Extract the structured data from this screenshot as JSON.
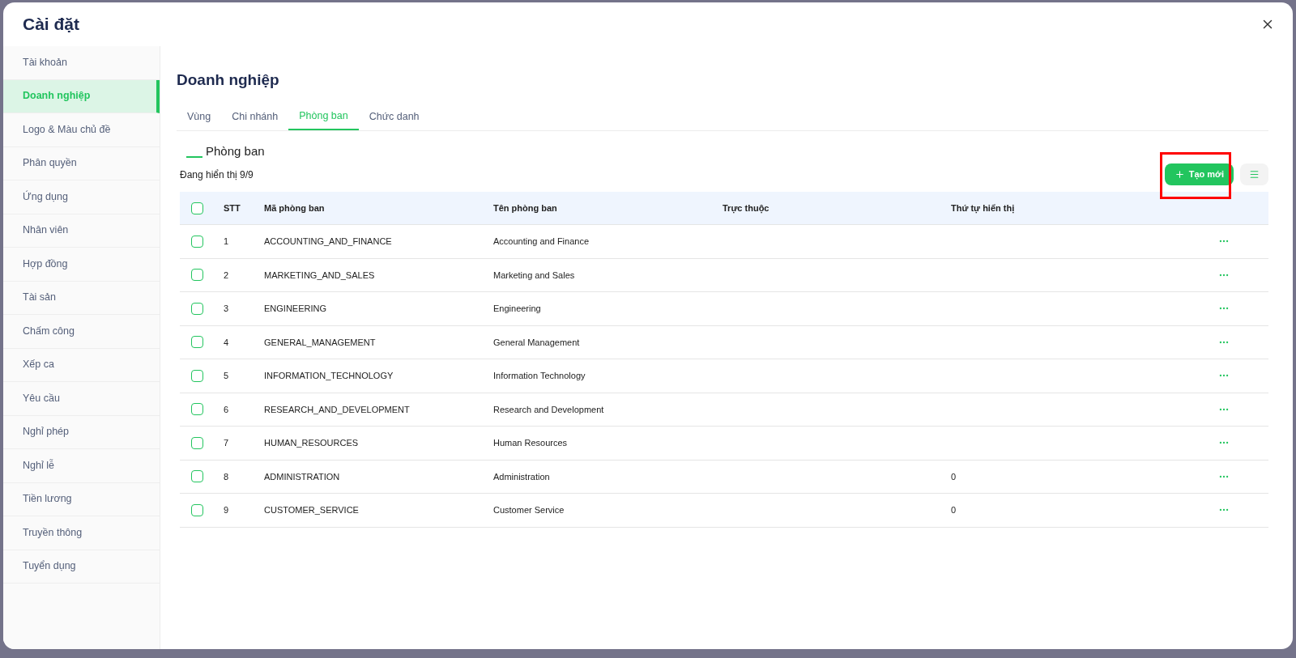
{
  "dialog": {
    "title": "Cài đặt"
  },
  "sidebar": {
    "items": [
      {
        "label": "Tài khoản",
        "selected": false
      },
      {
        "label": "Doanh nghiệp",
        "selected": true
      },
      {
        "label": "Logo & Màu chủ đề",
        "selected": false
      },
      {
        "label": "Phân quyền",
        "selected": false
      },
      {
        "label": "Ứng dụng",
        "selected": false
      },
      {
        "label": "Nhân viên",
        "selected": false
      },
      {
        "label": "Hợp đồng",
        "selected": false
      },
      {
        "label": "Tài sản",
        "selected": false
      },
      {
        "label": "Chấm công",
        "selected": false
      },
      {
        "label": "Xếp ca",
        "selected": false
      },
      {
        "label": "Yêu cầu",
        "selected": false
      },
      {
        "label": "Nghỉ phép",
        "selected": false
      },
      {
        "label": "Nghỉ lễ",
        "selected": false
      },
      {
        "label": "Tiền lương",
        "selected": false
      },
      {
        "label": "Truyền thông",
        "selected": false
      },
      {
        "label": "Tuyển dụng",
        "selected": false
      }
    ]
  },
  "content": {
    "heading": "Doanh nghiệp",
    "tabs": [
      {
        "label": "Vùng",
        "selected": false
      },
      {
        "label": "Chi nhánh",
        "selected": false
      },
      {
        "label": "Phòng ban",
        "selected": true
      },
      {
        "label": "Chức danh",
        "selected": false
      }
    ],
    "section_title": "Phòng ban",
    "count_text": "Đang hiển thị 9/9",
    "create_button": {
      "label": "Tạo mới",
      "highlighted": true
    },
    "table": {
      "select_all_checked": false,
      "columns": [
        "STT",
        "Mã phòng ban",
        "Tên phòng ban",
        "Trực thuộc",
        "Thứ tự hiển thị"
      ],
      "rows": [
        {
          "no": "1",
          "code": "ACCOUNTING_AND_FINANCE",
          "name": "Accounting and Finance",
          "checked": false
        },
        {
          "no": "2",
          "code": "MARKETING_AND_SALES",
          "name": "Marketing and Sales",
          "checked": false
        },
        {
          "no": "3",
          "code": "ENGINEERING",
          "name": "Engineering",
          "checked": false
        },
        {
          "no": "4",
          "code": "GENERAL_MANAGEMENT",
          "name": "General Management",
          "checked": false
        },
        {
          "no": "5",
          "code": "INFORMATION_TECHNOLOGY",
          "name": "Information Technology",
          "checked": false
        },
        {
          "no": "6",
          "code": "RESEARCH_AND_DEVELOPMENT",
          "name": "Research and Development",
          "checked": false
        },
        {
          "no": "7",
          "code": "HUMAN_RESOURCES",
          "name": "Human Resources",
          "checked": false
        },
        {
          "no": "8",
          "code": "ADMINISTRATION",
          "name": "Administration",
          "order": "0",
          "checked": false
        },
        {
          "no": "9",
          "code": "CUSTOMER_SERVICE",
          "name": "Customer Service",
          "order": "0",
          "checked": false
        }
      ]
    }
  }
}
